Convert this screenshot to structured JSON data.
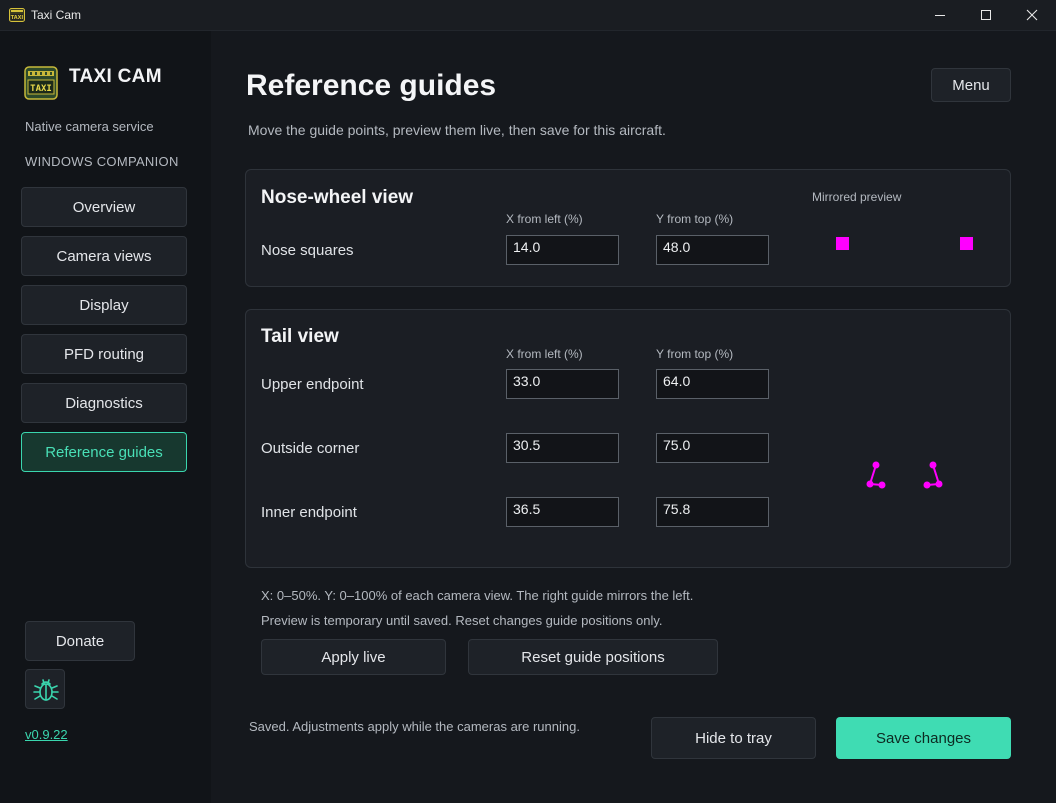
{
  "window": {
    "title": "Taxi Cam",
    "minimize_icon": "minimize-icon",
    "maximize_icon": "maximize-icon",
    "close_icon": "close-icon"
  },
  "sidebar": {
    "brand": "TAXI CAM",
    "brand_icon_text": "TAXI",
    "subtitle": "Native camera service",
    "companion": "WINDOWS COMPANION",
    "items": [
      {
        "label": "Overview",
        "active": false
      },
      {
        "label": "Camera views",
        "active": false
      },
      {
        "label": "Display",
        "active": false
      },
      {
        "label": "PFD routing",
        "active": false
      },
      {
        "label": "Diagnostics",
        "active": false
      },
      {
        "label": "Reference guides",
        "active": true
      }
    ],
    "donate_label": "Donate",
    "bug_icon": "bug-icon",
    "version": "v0.9.22"
  },
  "main": {
    "title": "Reference guides",
    "menu_label": "Menu",
    "subtitle": "Move the guide points, preview them live, then save for this aircraft.",
    "nose": {
      "title": "Nose-wheel view",
      "x_label": "X from left (%)",
      "y_label": "Y from top (%)",
      "preview_label": "Mirrored preview",
      "rows": [
        {
          "label": "Nose squares",
          "x": "14.0",
          "y": "48.0"
        }
      ]
    },
    "tail": {
      "title": "Tail view",
      "x_label": "X from left (%)",
      "y_label": "Y from top (%)",
      "rows": [
        {
          "label": "Upper endpoint",
          "x": "33.0",
          "y": "64.0"
        },
        {
          "label": "Outside corner",
          "x": "30.5",
          "y": "75.0"
        },
        {
          "label": "Inner endpoint",
          "x": "36.5",
          "y": "75.8"
        }
      ]
    },
    "note_range": "X: 0–50%. Y: 0–100% of each camera view. The right guide mirrors the left.",
    "note_preview": "Preview is temporary until saved. Reset changes guide positions only.",
    "apply_label": "Apply live",
    "reset_label": "Reset guide positions",
    "status": "Saved. Adjustments apply while the cameras are running.",
    "hide_label": "Hide to tray",
    "save_label": "Save changes"
  },
  "colors": {
    "accent": "#3fdcb3",
    "guide": "#ff00ff",
    "background": "#15181d",
    "sidebar": "#111418"
  }
}
